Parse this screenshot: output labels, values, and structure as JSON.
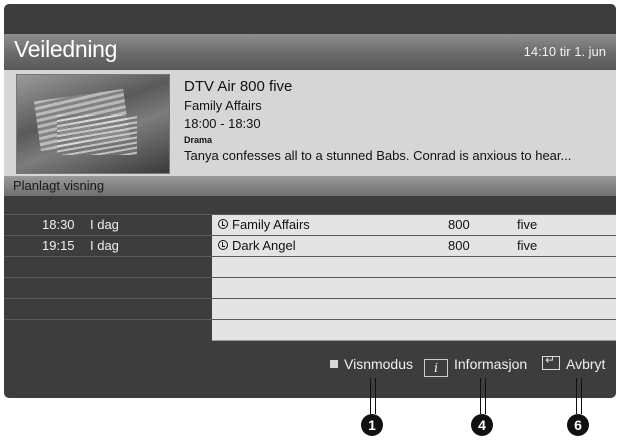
{
  "header": {
    "title": "Veiledning",
    "clock": "14:10 tir 1. jun"
  },
  "info": {
    "channel": "DTV Air 800 five",
    "program": "Family Affairs",
    "time": "18:00 - 18:30",
    "genre": "Drama",
    "description": "Tanya confesses all to a stunned Babs. Conrad is anxious to hear..."
  },
  "schedule": {
    "title": "Planlagt visning",
    "rows": [
      {
        "time": "18:30",
        "day": "I dag",
        "program": "Family Affairs",
        "channel_num": "800",
        "channel_name": "five"
      },
      {
        "time": "19:15",
        "day": "I dag",
        "program": "Dark Angel",
        "channel_num": "800",
        "channel_name": "five"
      },
      {
        "time": "",
        "day": "",
        "program": "",
        "channel_num": "",
        "channel_name": ""
      },
      {
        "time": "",
        "day": "",
        "program": "",
        "channel_num": "",
        "channel_name": ""
      },
      {
        "time": "",
        "day": "",
        "program": "",
        "channel_num": "",
        "channel_name": ""
      },
      {
        "time": "",
        "day": "",
        "program": "",
        "channel_num": "",
        "channel_name": ""
      }
    ]
  },
  "footer": {
    "view_mode": "Visnmodus",
    "information": "Informasjon",
    "cancel": "Avbryt",
    "info_key": "i"
  },
  "callouts": [
    "1",
    "4",
    "6"
  ]
}
